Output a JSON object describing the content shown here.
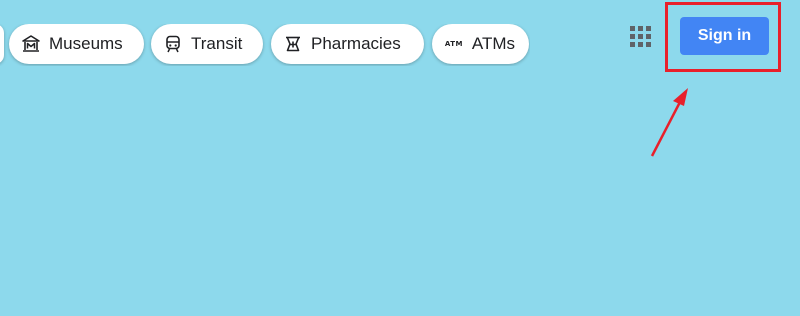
{
  "chips": [
    {
      "label": "Museums",
      "icon": "museum-icon"
    },
    {
      "label": "Transit",
      "icon": "train-icon"
    },
    {
      "label": "Pharmacies",
      "icon": "pharmacy-icon"
    },
    {
      "label": "ATMs",
      "icon": "atm-icon",
      "icon_text": "ATM"
    }
  ],
  "header": {
    "apps_icon": "apps-grid-icon",
    "sign_in_label": "Sign in",
    "sign_in_color": "#4285f4"
  },
  "annotation": {
    "highlight_color": "#e8202b"
  },
  "colors": {
    "map_background": "#8dd9ec"
  }
}
